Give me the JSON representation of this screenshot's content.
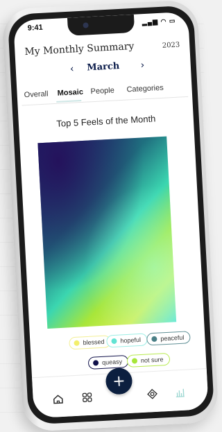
{
  "status": {
    "time": "9:41",
    "icons": [
      "signal-icon",
      "wifi-icon",
      "battery-icon"
    ]
  },
  "header": {
    "title": "My Monthly Summary",
    "year": "2023"
  },
  "month_nav": {
    "month": "March",
    "prev_symbol": "‹",
    "next_symbol": "›"
  },
  "tabs": [
    {
      "label": "Overall",
      "active": false
    },
    {
      "label": "Mosaic",
      "active": true
    },
    {
      "label": "People",
      "active": false
    },
    {
      "label": "Categories",
      "active": false
    }
  ],
  "mosaic": {
    "title": "Top 5 Feels of the Month"
  },
  "legend": [
    {
      "label": "blessed",
      "color": "#f3ef6b"
    },
    {
      "label": "hopeful",
      "color": "#62e3d3"
    },
    {
      "label": "peaceful",
      "color": "#4a7f86"
    },
    {
      "label": "queasy",
      "color": "#10114a"
    },
    {
      "label": "not sure",
      "color": "#a7e63a"
    }
  ],
  "bottom_nav": {
    "items": [
      "home-icon",
      "grid-icon",
      "add-icon",
      "settings-icon",
      "stats-icon"
    ],
    "fab_label": "+"
  },
  "colors": {
    "brand_navy": "#0c1f3f",
    "active_tab_underline": "#cfe7e6"
  }
}
